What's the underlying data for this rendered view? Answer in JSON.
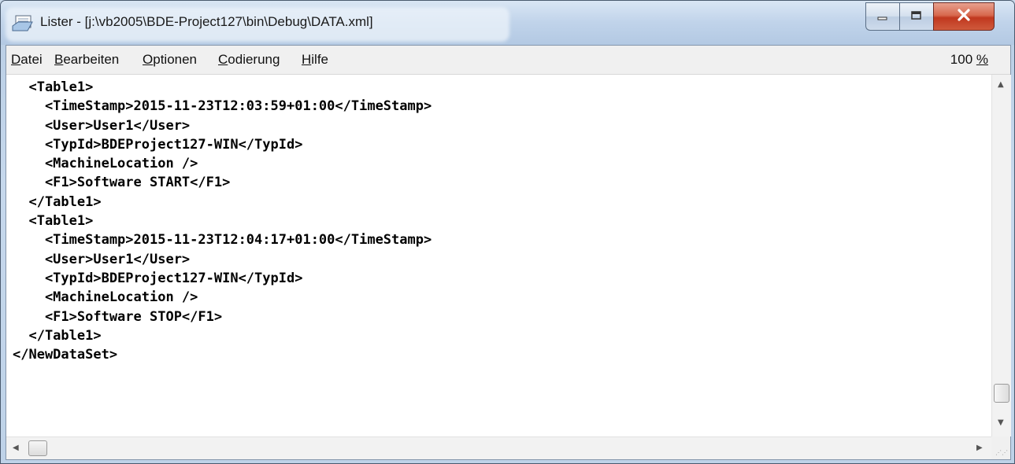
{
  "window": {
    "title": "Lister - [j:\\vb2005\\BDE-Project127\\bin\\Debug\\DATA.xml]",
    "app_icon": "lister-app-icon",
    "buttons": {
      "minimize_icon": "minimize-icon",
      "maximize_icon": "maximize-icon",
      "close_icon": "close-icon"
    }
  },
  "menu": {
    "items": [
      {
        "label": "Datei",
        "accesskey": "D"
      },
      {
        "label": "Bearbeiten",
        "accesskey": "B"
      },
      {
        "label": "Optionen",
        "accesskey": "O"
      },
      {
        "label": "Codierung",
        "accesskey": "C"
      },
      {
        "label": "Hilfe",
        "accesskey": "H"
      }
    ],
    "zoom": "100 %"
  },
  "content": {
    "lines": [
      "  <Table1>",
      "    <TimeStamp>2015-11-23T12:03:59+01:00</TimeStamp>",
      "    <User>User1</User>",
      "    <TypId>BDEProject127-WIN</TypId>",
      "    <MachineLocation />",
      "    <F1>Software START</F1>",
      "  </Table1>",
      "  <Table1>",
      "    <TimeStamp>2015-11-23T12:04:17+01:00</TimeStamp>",
      "    <User>User1</User>",
      "    <TypId>BDEProject127-WIN</TypId>",
      "    <MachineLocation />",
      "    <F1>Software STOP</F1>",
      "  </Table1>",
      "</NewDataSet>"
    ]
  },
  "scrollbars": {
    "vertical_position": 0.95,
    "horizontal_position": 0.0
  },
  "colors": {
    "close_button": "#c7442a",
    "titlebar": "#c0d3ea",
    "content_bg": "#ffffff"
  }
}
